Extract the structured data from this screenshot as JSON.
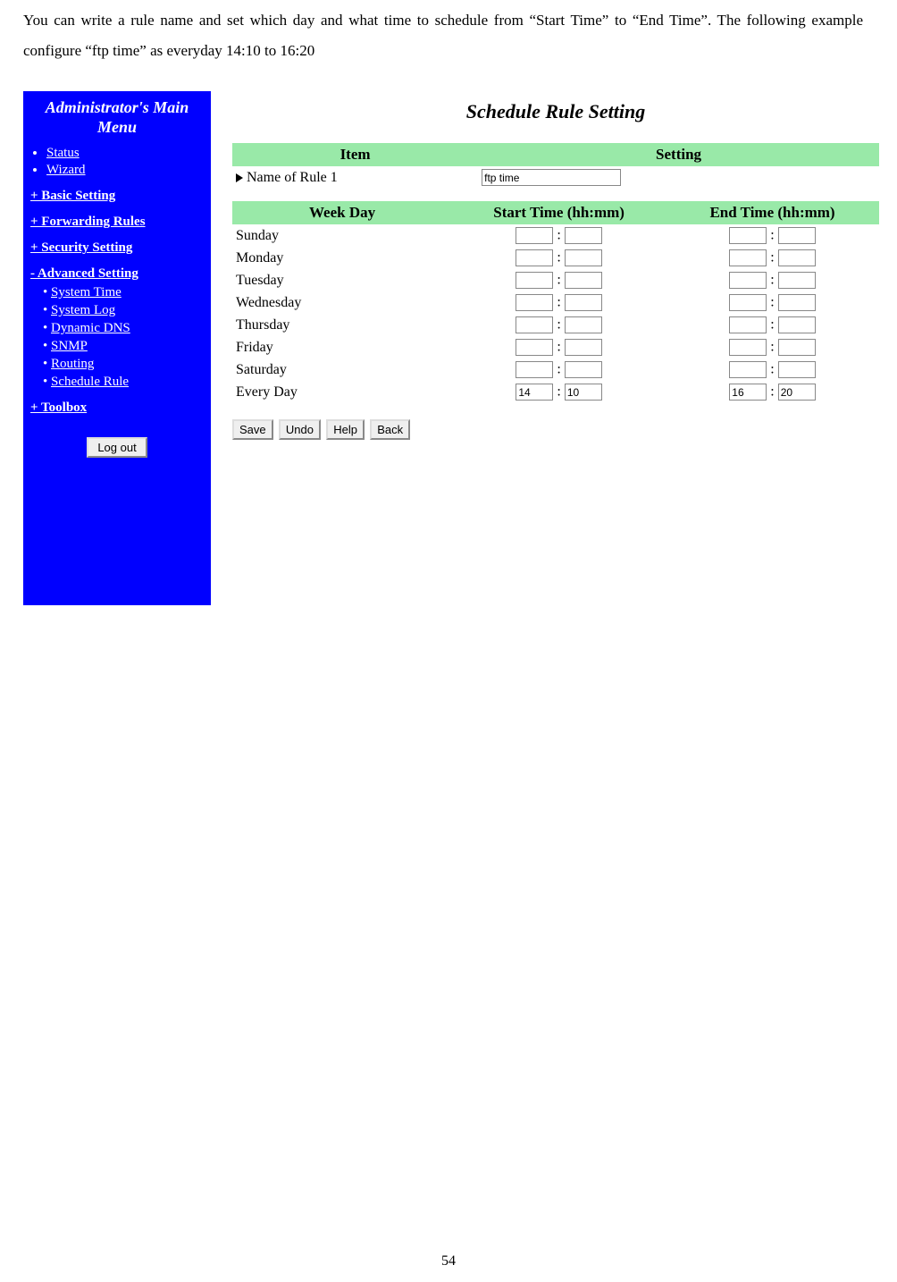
{
  "intro": "You can write a rule name and set which day and what time to schedule from “Start Time” to “End Time”. The following example configure “ftp time” as everyday 14:10 to 16:20",
  "page_number": "54",
  "sidebar": {
    "title_line1": "Administrator's Main",
    "title_line2": "Menu",
    "top": [
      "Status",
      "Wizard"
    ],
    "basic": "+ Basic Setting",
    "forwarding": "+ Forwarding Rules",
    "security": "+ Security Setting",
    "advanced": "- Advanced Setting",
    "adv_items": [
      "System Time",
      "System Log",
      "Dynamic DNS",
      "SNMP",
      "Routing",
      "Schedule Rule"
    ],
    "toolbox": "+ Toolbox",
    "logout": "Log out"
  },
  "main": {
    "title": "Schedule Rule Setting",
    "item_header": "Item",
    "setting_header": "Setting",
    "rule_label": "Name of Rule 1",
    "rule_value": "ftp time",
    "weekday_header": "Week Day",
    "start_header": "Start Time (hh:mm)",
    "end_header": "End Time (hh:mm)",
    "days": [
      {
        "name": "Sunday",
        "sh": "",
        "sm": "",
        "eh": "",
        "em": ""
      },
      {
        "name": "Monday",
        "sh": "",
        "sm": "",
        "eh": "",
        "em": ""
      },
      {
        "name": "Tuesday",
        "sh": "",
        "sm": "",
        "eh": "",
        "em": ""
      },
      {
        "name": "Wednesday",
        "sh": "",
        "sm": "",
        "eh": "",
        "em": ""
      },
      {
        "name": "Thursday",
        "sh": "",
        "sm": "",
        "eh": "",
        "em": ""
      },
      {
        "name": "Friday",
        "sh": "",
        "sm": "",
        "eh": "",
        "em": ""
      },
      {
        "name": "Saturday",
        "sh": "",
        "sm": "",
        "eh": "",
        "em": ""
      },
      {
        "name": "Every Day",
        "sh": "14",
        "sm": "10",
        "eh": "16",
        "em": "20"
      }
    ],
    "buttons": {
      "save": "Save",
      "undo": "Undo",
      "help": "Help",
      "back": "Back"
    }
  }
}
